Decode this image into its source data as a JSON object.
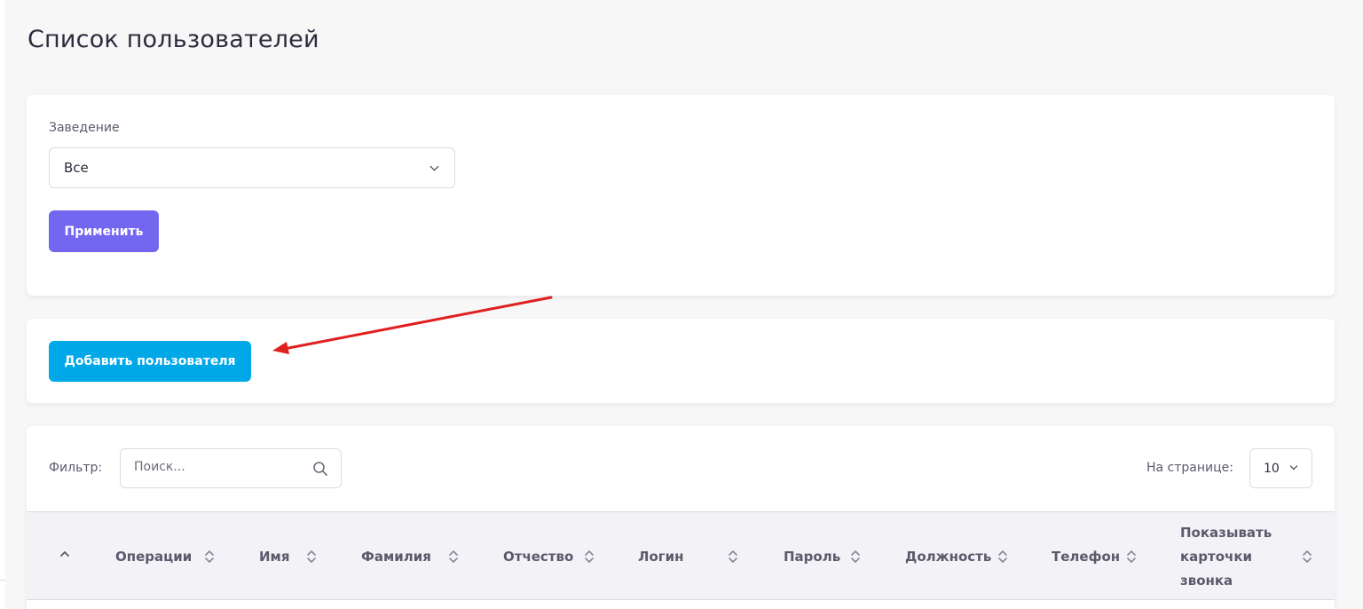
{
  "page": {
    "title": "Список пользователей"
  },
  "filter_card": {
    "establishment_label": "Заведение",
    "establishment_value": "Все",
    "apply_label": "Применить"
  },
  "add_card": {
    "add_user_label": "Добавить пользователя"
  },
  "table_card": {
    "filter_label": "Фильтр:",
    "search_placeholder": "Поиск...",
    "per_page_label": "На странице:",
    "per_page_value": "10",
    "columns": [
      "Операции",
      "Имя",
      "Фамилия",
      "Отчество",
      "Логин",
      "Пароль",
      "Должность",
      "Телефон",
      "Показывать карточки звонка"
    ]
  },
  "colors": {
    "primary": "#7367f0",
    "info": "#00a8e8",
    "annotation_arrow": "#e02020"
  },
  "icons": {
    "search": "search-icon",
    "dropdown": "chevron-down-icon",
    "sort": "sort-icon"
  }
}
